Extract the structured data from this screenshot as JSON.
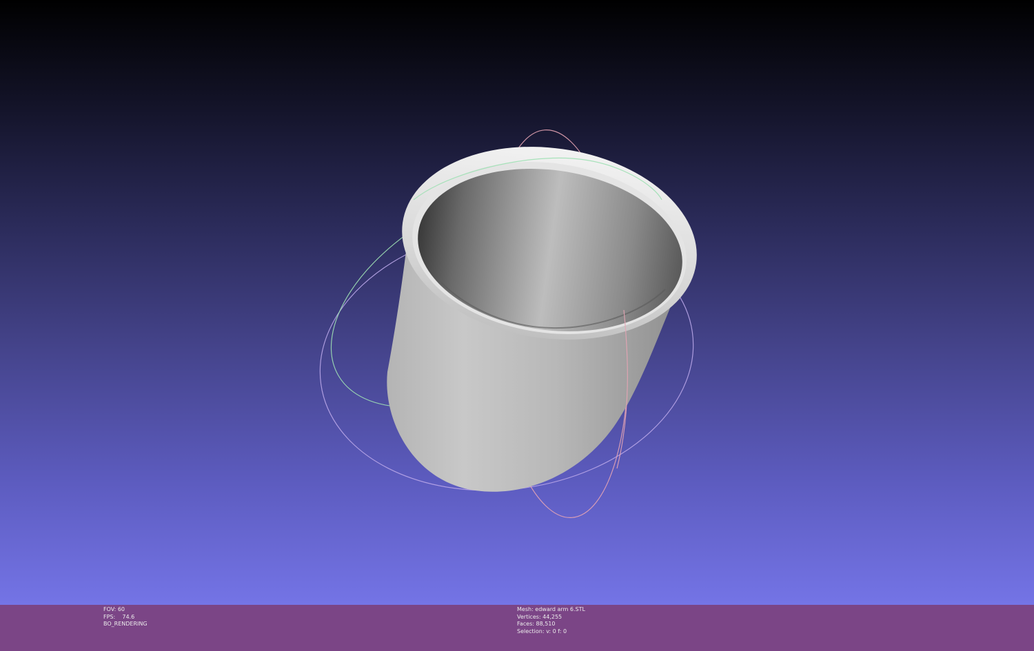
{
  "app": "MeshLab",
  "viewport": {
    "background_top": "#000000",
    "background_bottom": "#7474e6",
    "trackball_colors": {
      "x_ring": "#e6a0a0",
      "y_ring": "#a0e6b0",
      "z_ring": "#c8b4ff"
    }
  },
  "info_left": {
    "fov_label": "FOV: 60",
    "fps_label": "FPS:    74.6",
    "render_mode": "BO_RENDERING"
  },
  "info_right": {
    "mesh_label": "Mesh: edward arm 6.STL",
    "vertices_label": "Vertices: 44,255",
    "faces_label": "Faces: 88,510",
    "selection_label": "Selection: v: 0 f: 0"
  },
  "infobar": {
    "background": "#7b4586"
  }
}
